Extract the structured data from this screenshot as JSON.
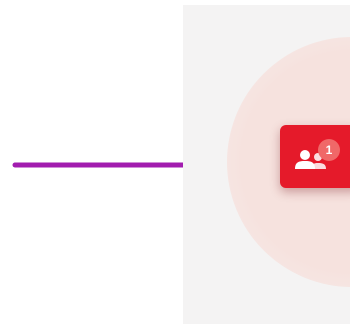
{
  "colors": {
    "arrow": "#a21caf",
    "panel_background": "#f4f3f3",
    "glow": "#f6e2de",
    "button": "#e51a2a",
    "badge": "#f06868",
    "icon": "#ffffff"
  },
  "users_button": {
    "icon": "users-icon",
    "notification_count": "1"
  }
}
